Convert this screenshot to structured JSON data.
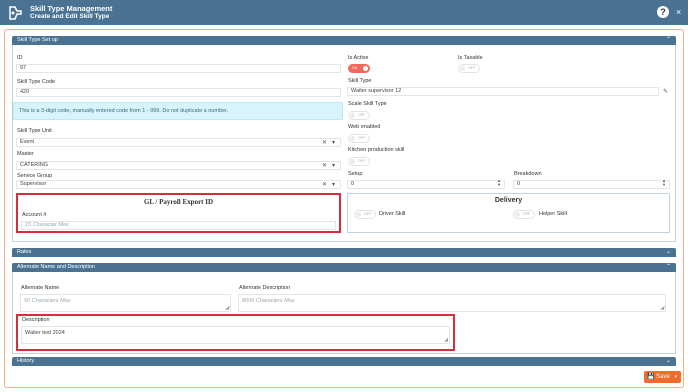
{
  "header": {
    "title": "Skill Type Management",
    "subtitle": "Create and Edit Skill Type",
    "help": "?",
    "close": "×"
  },
  "setup": {
    "section_title": "Skill Type Set up",
    "id_label": "ID",
    "id_value": "97",
    "code_label": "Skill Type Code",
    "code_value": "420",
    "info_text": "This is a 3-digit code, manually entered code from 1 - 999. Do not duplicate a number.",
    "unit_label": "Skill Type Unit",
    "unit_value": "Event",
    "master_label": "Master",
    "master_value": "CATERING",
    "service_group_label": "Service Group",
    "service_group_value": "Supervisor",
    "is_active_label": "Is Active",
    "is_active_state": "ON",
    "is_taxable_label": "Is Taxable",
    "is_taxable_state": "OFF",
    "skill_type_label": "Skill Type",
    "skill_type_value": "Waiter supervisor 12",
    "scale_label": "Scale Skill Type",
    "scale_state": "OFF",
    "web_label": "Web enabled",
    "web_state": "OFF",
    "kitchen_label": "Kitchen production skill",
    "kitchen_state": "OFF",
    "setup_label": "Setup",
    "setup_value": "0",
    "breakdown_label": "Breakdown",
    "breakdown_value": "0",
    "gl_title": "GL / Payroll Export ID",
    "account_label": "Account #",
    "account_placeholder": "15 Character Max",
    "delivery_title": "Delivery",
    "driver_label": "Driver Skill",
    "driver_state": "OFF",
    "helper_label": "Helper Skill",
    "helper_state": "OFF"
  },
  "rates": {
    "section_title": "Rates"
  },
  "alternate": {
    "section_title": "Alternate Name and Description",
    "name_label": "Alternate Name",
    "name_placeholder": "50 Characters Max",
    "desc_label": "Alternate Description",
    "desc_placeholder": "8000 Characters Max",
    "description_label": "Description",
    "description_value": "Waiter test 2024"
  },
  "history": {
    "section_title": "History"
  },
  "footer": {
    "save_label": "Save"
  },
  "colors": {
    "header": "#4a7393",
    "toggle_on": "#f06b5b",
    "highlight": "#d62e3c",
    "save": "#f26b2c"
  }
}
